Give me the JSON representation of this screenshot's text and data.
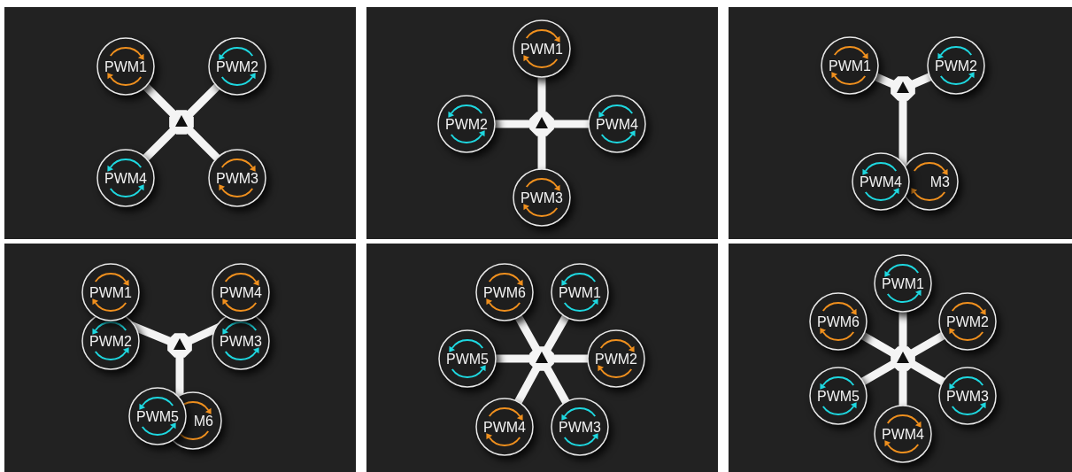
{
  "frames": [
    {
      "kind": "quad_x",
      "motors": [
        {
          "label": "PWM1",
          "clockwise": true
        },
        {
          "label": "PWM2",
          "clockwise": false
        },
        {
          "label": "PWM4",
          "clockwise": false
        },
        {
          "label": "PWM3",
          "clockwise": true
        }
      ]
    },
    {
      "kind": "quad_plus",
      "motors": [
        {
          "label": "PWM1",
          "clockwise": true
        },
        {
          "label": "PWM2",
          "clockwise": false
        },
        {
          "label": "PWM4",
          "clockwise": false
        },
        {
          "label": "PWM3",
          "clockwise": true
        }
      ]
    },
    {
      "kind": "tri",
      "motors": [
        {
          "label": "PWM1",
          "clockwise": true
        },
        {
          "label": "PWM2",
          "clockwise": false
        },
        {
          "label": "PWM4",
          "clockwise": false
        },
        {
          "label": "M3",
          "clockwise": true,
          "partly_hidden": true
        }
      ]
    },
    {
      "kind": "y6",
      "motors": [
        {
          "label": "PWM1",
          "clockwise": true
        },
        {
          "label": "PWM4",
          "clockwise": true
        },
        {
          "label": "PWM2",
          "clockwise": false
        },
        {
          "label": "PWM3",
          "clockwise": false
        },
        {
          "label": "PWM5",
          "clockwise": false
        },
        {
          "label": "M6",
          "clockwise": true,
          "partly_hidden": true
        }
      ]
    },
    {
      "kind": "hex_x",
      "motors": [
        {
          "label": "PWM6",
          "clockwise": true
        },
        {
          "label": "PWM1",
          "clockwise": false
        },
        {
          "label": "PWM5",
          "clockwise": false
        },
        {
          "label": "PWM2",
          "clockwise": true
        },
        {
          "label": "PWM4",
          "clockwise": true
        },
        {
          "label": "PWM3",
          "clockwise": false
        }
      ]
    },
    {
      "kind": "hex_plus",
      "motors": [
        {
          "label": "PWM1",
          "clockwise": false
        },
        {
          "label": "PWM6",
          "clockwise": true
        },
        {
          "label": "PWM2",
          "clockwise": true
        },
        {
          "label": "PWM5",
          "clockwise": false
        },
        {
          "label": "PWM3",
          "clockwise": false
        },
        {
          "label": "PWM4",
          "clockwise": true
        }
      ]
    }
  ]
}
